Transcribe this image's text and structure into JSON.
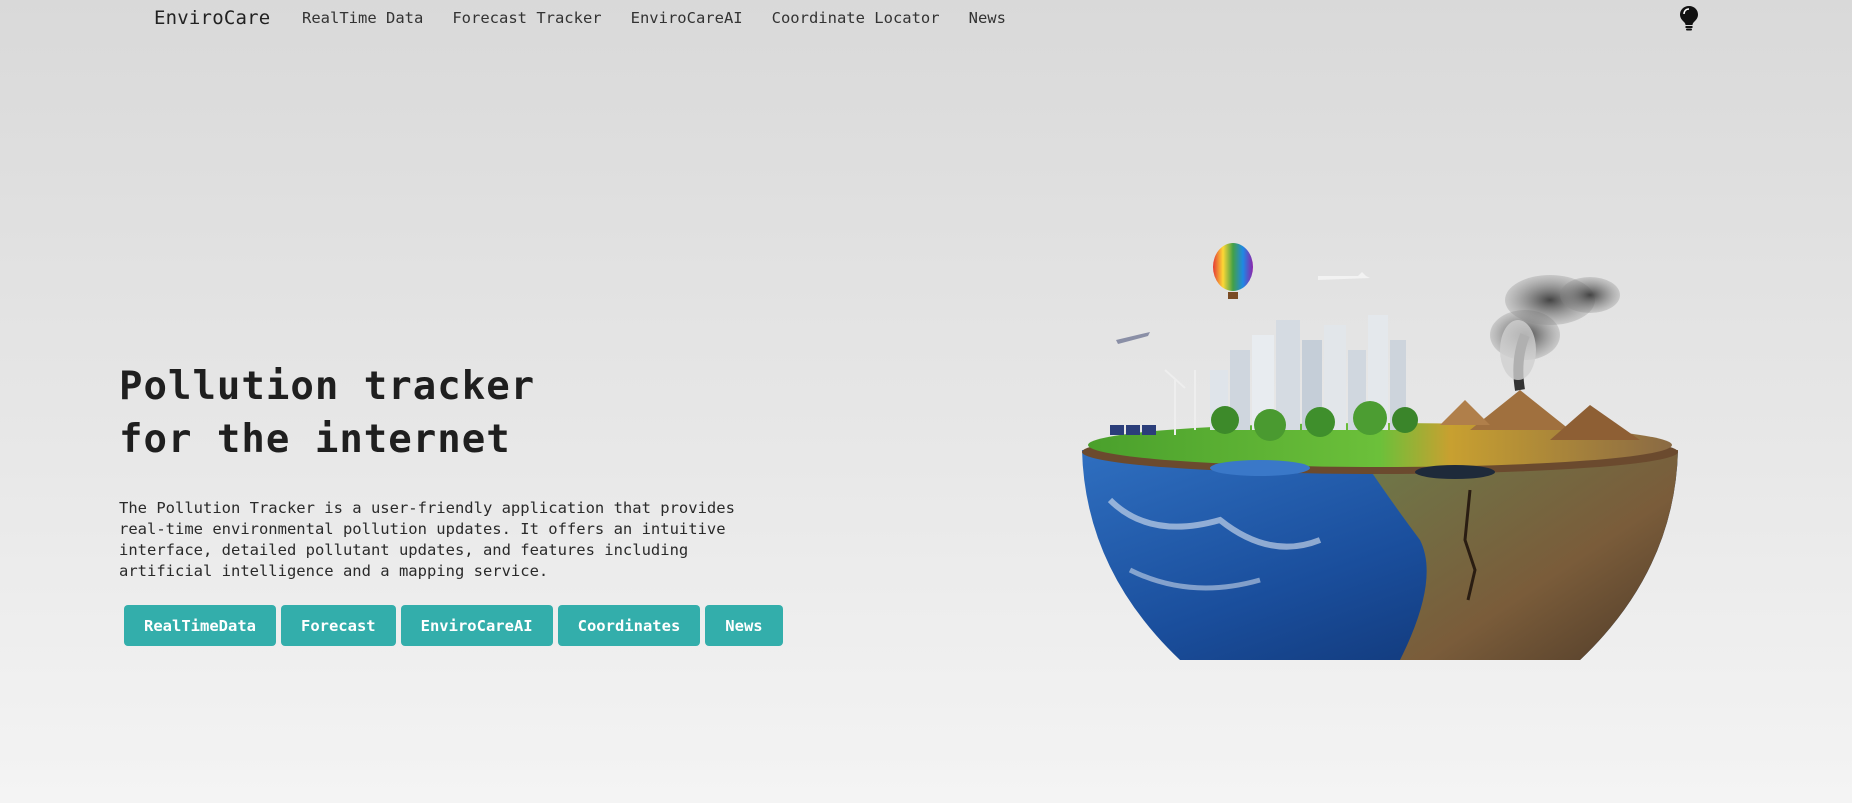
{
  "nav": {
    "brand": "EnviroCare",
    "links": [
      "RealTime Data",
      "Forecast Tracker",
      "EnviroCareAI",
      "Coordinate Locator",
      "News"
    ],
    "theme_icon": "lightbulb-icon"
  },
  "hero": {
    "title_line1": "Pollution tracker",
    "title_line2": "for the internet",
    "description": "The Pollution Tracker is a user-friendly application that provides real-time environmental pollution updates. It offers an intuitive interface, detailed pollutant updates, and features including artificial intelligence and a mapping service.",
    "buttons": [
      "RealTimeData",
      "Forecast",
      "EnviroCareAI",
      "Coordinates",
      "News"
    ],
    "illustration": "half-earth-globe-illustration"
  },
  "colors": {
    "accent": "#33aeab",
    "background_top": "#d9d9d9",
    "background_bottom": "#f4f4f4"
  }
}
